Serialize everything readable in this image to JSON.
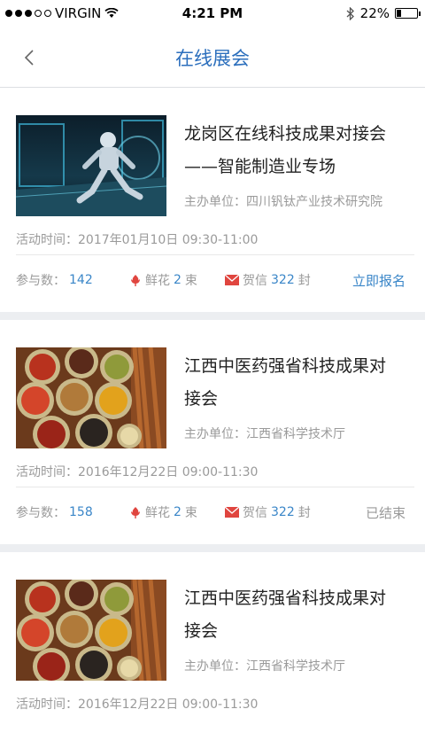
{
  "status_bar": {
    "carrier": "VIRGIN",
    "time": "4:21 PM",
    "battery_percent": "22%",
    "battery_level": 0.22
  },
  "nav": {
    "title": "在线展会"
  },
  "events": [
    {
      "title_lines": [
        "龙岗区在线科技成果对接会",
        "——智能制造业专场"
      ],
      "host": "主办单位：四川钒钛产业技术研究院",
      "time": "活动时间：2017年01月10日 09:30-11:00",
      "participants_label": "参与数：",
      "participants": "142",
      "flowers_label": "鲜花",
      "flowers": "2",
      "flowers_unit": "束",
      "letters_label": "贺信",
      "letters": "322",
      "letters_unit": "封",
      "action": "立即报名",
      "image": "robot-thumbnail"
    },
    {
      "title_lines": [
        "江西中医药强省科技成果对",
        "接会"
      ],
      "host": "主办单位：江西省科学技术厅",
      "time": "活动时间：2016年12月22日 09:00-11:30",
      "participants_label": "参与数：",
      "participants": "158",
      "flowers_label": "鲜花",
      "flowers": "2",
      "flowers_unit": "束",
      "letters_label": "贺信",
      "letters": "322",
      "letters_unit": "封",
      "action": "已结束",
      "image": "spices-thumbnail"
    },
    {
      "title_lines": [
        "江西中医药强省科技成果对",
        "接会"
      ],
      "host": "主办单位：江西省科学技术厅",
      "time": "活动时间：2016年12月22日 09:00-11:30",
      "image": "spices-thumbnail"
    }
  ],
  "colors": {
    "accent": "#2c6fbd",
    "number": "#3a86c8",
    "flower": "#e0453f",
    "letter": "#e0453f"
  }
}
